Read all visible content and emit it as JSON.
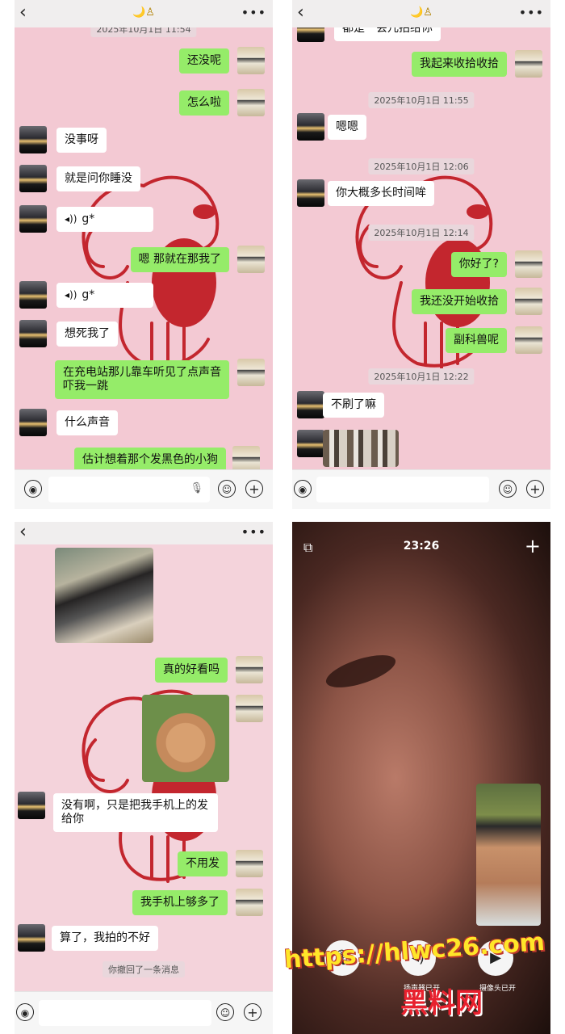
{
  "panel1": {
    "title_icons": "🌙♙",
    "cropped_timestamp": "2025年10月1日 11:54",
    "messages": [
      {
        "side": "right",
        "text": "还没呢"
      },
      {
        "side": "right",
        "text": "怎么啦"
      },
      {
        "side": "left",
        "text": "没事呀"
      },
      {
        "side": "left",
        "text": "就是问你睡没"
      },
      {
        "side": "left",
        "voice": "g*"
      },
      {
        "side": "right",
        "text": "嗯 那就在那我了"
      },
      {
        "side": "left",
        "voice": "g*"
      },
      {
        "side": "left",
        "text": "想死我了"
      },
      {
        "side": "right",
        "text": "在充电站那儿靠车听见了点声音吓我一跳"
      },
      {
        "side": "left",
        "text": "什么声音"
      },
      {
        "side": "right",
        "text": "估计想着那个发黑色的小狗"
      }
    ]
  },
  "panel2": {
    "title_icons": "🌙♙",
    "cropped_text": "都是一会儿拍给你",
    "messages": {
      "m1": "我起来收拾收拾",
      "ts1": "2025年10月1日 11:55",
      "m2": "嗯嗯",
      "ts2": "2025年10月1日 12:06",
      "m3": "你大概多长时间哞",
      "ts3": "2025年10月1日 12:14",
      "m4": "你好了?",
      "m5": "我还没开始收拾",
      "m6": "副科兽呢",
      "ts4": "2025年10月1日 12:22",
      "m7": "不刷了嘛"
    }
  },
  "panel3": {
    "messages": {
      "m1": "真的好看吗",
      "m2": "没有啊，只是把我手机上的发给你",
      "m3": "不用发",
      "m4": "我手机上够多了",
      "m5": "算了，我拍的不好",
      "recall": "你撤回了一条消息"
    }
  },
  "panel4": {
    "call_time": "23:26",
    "speaker_label": "扬声器已开",
    "camera_label": "摄像头已开"
  },
  "watermark": {
    "url": "https://hlwc26.com",
    "name": "黑料网"
  },
  "icons": {
    "back": "‹",
    "more": "•••",
    "voice": "◉",
    "mic": "🎙",
    "emoji": "☺",
    "plus": "+"
  }
}
